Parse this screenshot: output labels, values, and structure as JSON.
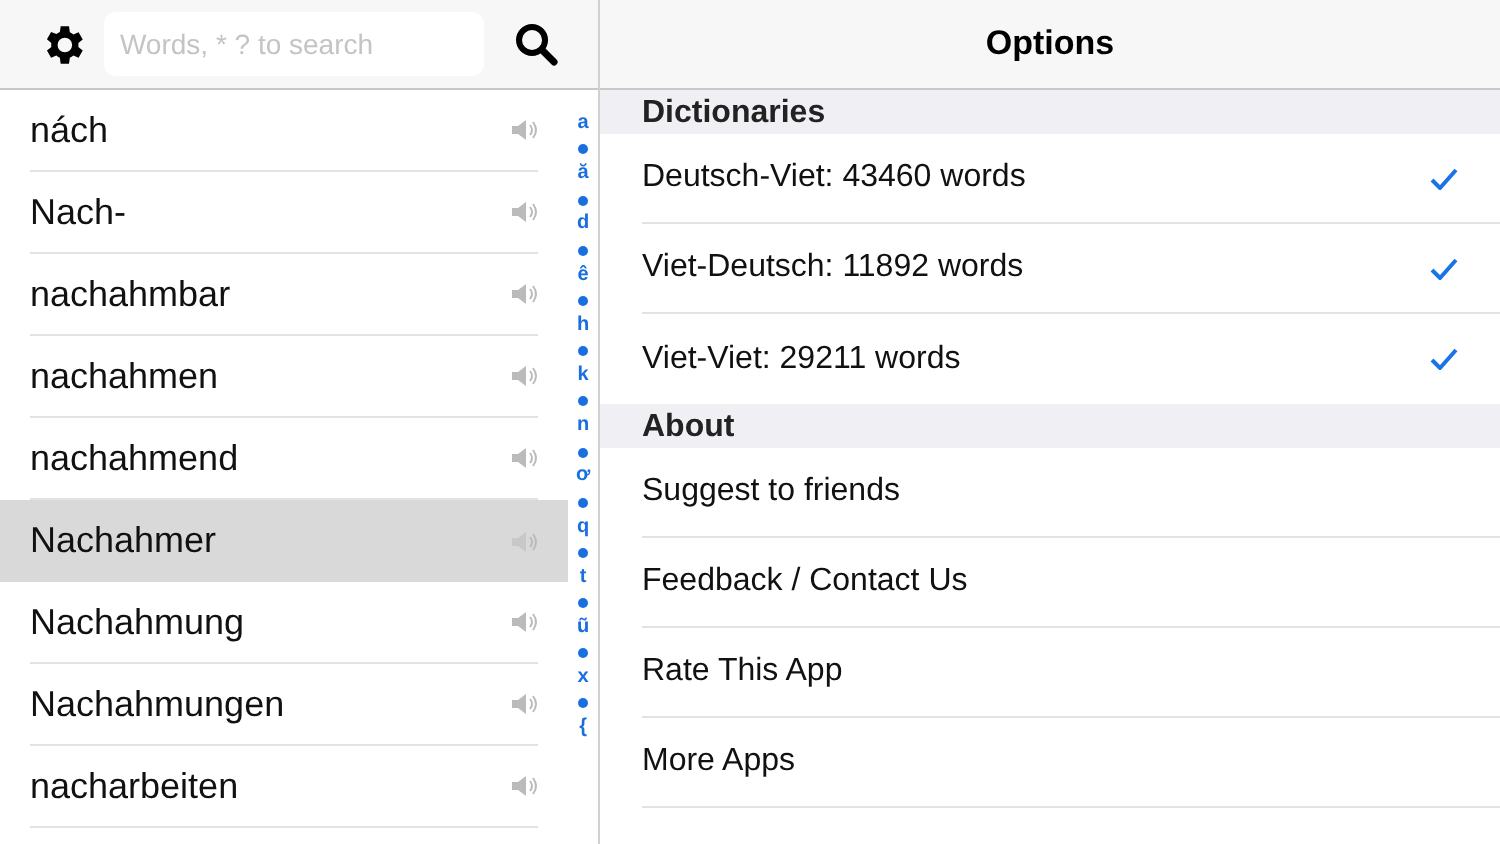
{
  "search": {
    "placeholder": "Words, * ? to search"
  },
  "words": [
    {
      "text": "nách",
      "selected": false
    },
    {
      "text": "Nach-",
      "selected": false
    },
    {
      "text": "nachahmbar",
      "selected": false
    },
    {
      "text": "nachahmen",
      "selected": false
    },
    {
      "text": "nachahmend",
      "selected": false
    },
    {
      "text": "Nachahmer",
      "selected": true
    },
    {
      "text": "Nachahmung",
      "selected": false
    },
    {
      "text": "Nachahmungen",
      "selected": false
    },
    {
      "text": "nacharbeiten",
      "selected": false
    }
  ],
  "index": [
    "a",
    "ă",
    "d",
    "ê",
    "h",
    "k",
    "n",
    "ơ",
    "q",
    "t",
    "ũ",
    "x",
    "{"
  ],
  "options": {
    "title": "Options",
    "sections": [
      {
        "title": "Dictionaries",
        "items": [
          {
            "label": "Deutsch-Viet: 43460 words",
            "checked": true
          },
          {
            "label": "Viet-Deutsch: 11892 words",
            "checked": true
          },
          {
            "label": "Viet-Viet: 29211 words",
            "checked": true
          }
        ]
      },
      {
        "title": "About",
        "items": [
          {
            "label": "Suggest to friends"
          },
          {
            "label": "Feedback / Contact Us"
          },
          {
            "label": "Rate This App"
          },
          {
            "label": "More Apps"
          }
        ]
      }
    ]
  }
}
